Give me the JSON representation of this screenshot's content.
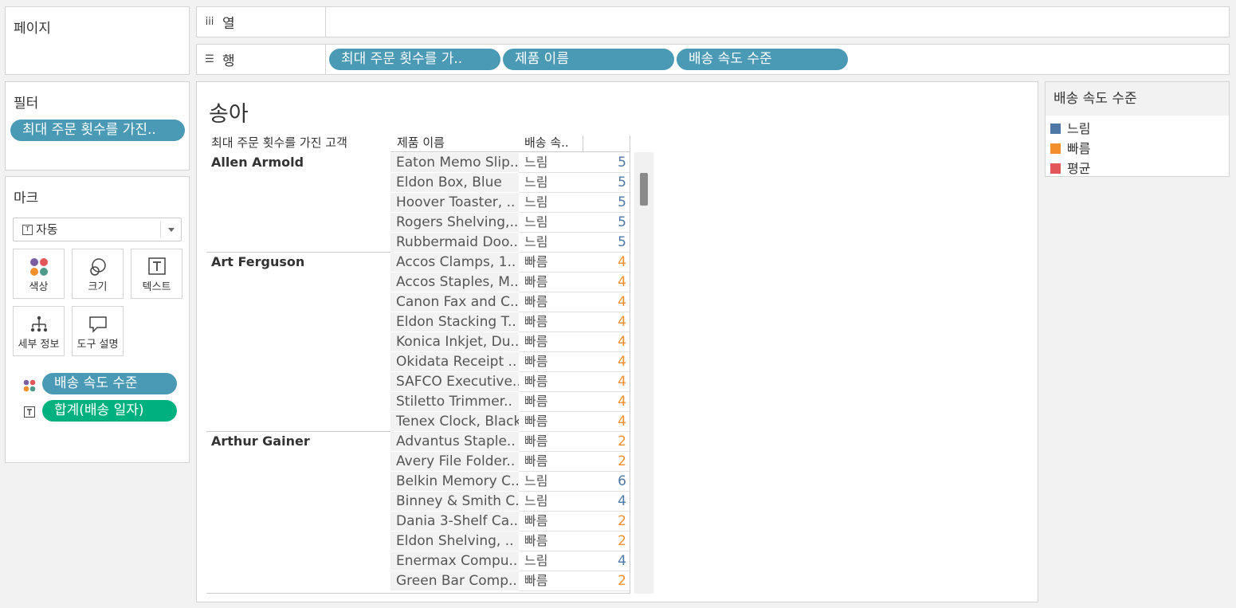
{
  "pages": {
    "title": "페이지"
  },
  "columns_shelf": {
    "label": "열",
    "icon": "iii"
  },
  "rows_shelf": {
    "label": "행",
    "icon": "☰",
    "pills": [
      "최대 주문 횟수를 가..",
      "제품 이름",
      "배송 속도 수준"
    ]
  },
  "filters": {
    "title": "필터",
    "pills": [
      "최대 주문 횟수를 가진.."
    ]
  },
  "marks": {
    "title": "마크",
    "mark_type": "자동",
    "buttons": {
      "color": "색상",
      "size": "크기",
      "text": "텍스트",
      "detail": "세부 정보",
      "tooltip": "도구 설명"
    },
    "pills": [
      "배송 속도 수준",
      "합계(배송 일자)"
    ]
  },
  "view": {
    "title": "송아",
    "headers": {
      "customer": "최대 주문 횟수를 가진 고객",
      "product": "제품 이름",
      "speed": "배송 속.."
    },
    "groups": [
      {
        "customer": "Allen Armold",
        "rows": [
          {
            "product": "Eaton Memo Slip..",
            "speed": "느림",
            "value": "5"
          },
          {
            "product": "Eldon Box, Blue",
            "speed": "느림",
            "value": "5"
          },
          {
            "product": "Hoover Toaster, ..",
            "speed": "느림",
            "value": "5"
          },
          {
            "product": "Rogers Shelving,..",
            "speed": "느림",
            "value": "5"
          },
          {
            "product": "Rubbermaid Doo..",
            "speed": "느림",
            "value": "5"
          }
        ]
      },
      {
        "customer": "Art Ferguson",
        "rows": [
          {
            "product": "Accos Clamps, 1..",
            "speed": "빠름",
            "value": "4"
          },
          {
            "product": "Accos Staples, M..",
            "speed": "빠름",
            "value": "4"
          },
          {
            "product": "Canon Fax and C..",
            "speed": "빠름",
            "value": "4"
          },
          {
            "product": "Eldon Stacking T..",
            "speed": "빠름",
            "value": "4"
          },
          {
            "product": "Konica Inkjet, Du..",
            "speed": "빠름",
            "value": "4"
          },
          {
            "product": "Okidata Receipt ..",
            "speed": "빠름",
            "value": "4"
          },
          {
            "product": "SAFCO Executive..",
            "speed": "빠름",
            "value": "4"
          },
          {
            "product": "Stiletto Trimmer..",
            "speed": "빠름",
            "value": "4"
          },
          {
            "product": "Tenex Clock, Black",
            "speed": "빠름",
            "value": "4"
          }
        ]
      },
      {
        "customer": "Arthur Gainer",
        "rows": [
          {
            "product": "Advantus Staple..",
            "speed": "빠름",
            "value": "2"
          },
          {
            "product": "Avery File Folder..",
            "speed": "빠름",
            "value": "2"
          },
          {
            "product": "Belkin Memory C..",
            "speed": "느림",
            "value": "6"
          },
          {
            "product": "Binney & Smith C..",
            "speed": "느림",
            "value": "4"
          },
          {
            "product": "Dania 3-Shelf Ca..",
            "speed": "빠름",
            "value": "2"
          },
          {
            "product": "Eldon Shelving, ..",
            "speed": "빠름",
            "value": "2"
          },
          {
            "product": "Enermax Compu..",
            "speed": "느림",
            "value": "4"
          },
          {
            "product": "Green Bar Comp..",
            "speed": "빠름",
            "value": "2"
          }
        ]
      }
    ]
  },
  "legend": {
    "title": "배송 속도 수준",
    "items": [
      {
        "label": "느림",
        "color": "#4e79a7"
      },
      {
        "label": "빠름",
        "color": "#f28e2b"
      },
      {
        "label": "평균",
        "color": "#e15759"
      }
    ]
  },
  "colors": {
    "slow": "#4e79a7",
    "fast": "#f28e2b",
    "pill_blue": "#4b9ab5",
    "pill_green": "#00b180"
  }
}
